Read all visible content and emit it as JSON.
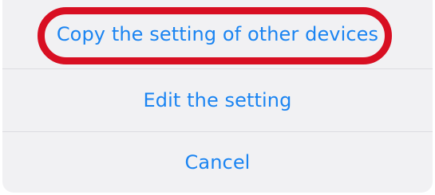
{
  "action_sheet": {
    "items": [
      {
        "label": "Copy the setting of other devices"
      },
      {
        "label": "Edit the setting"
      },
      {
        "label": "Cancel"
      }
    ],
    "highlighted_item": "Copy the setting of other devices"
  },
  "colors": {
    "accent": "#1a84f2",
    "sheet_background": "#f1f1f3",
    "separator": "#dcdce0",
    "highlight_ring": "#d80f22"
  }
}
